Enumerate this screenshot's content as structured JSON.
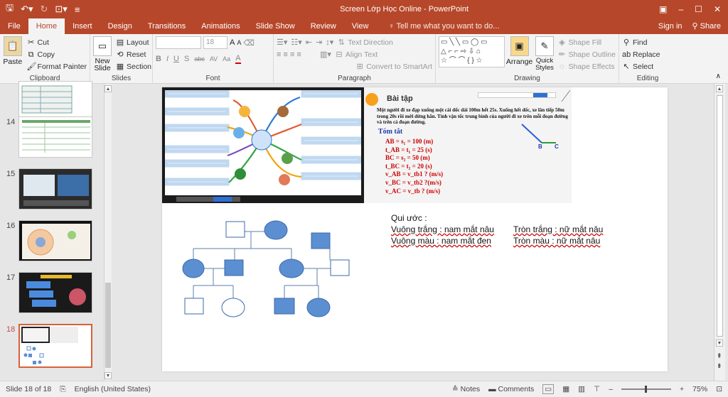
{
  "window": {
    "title": "Screen Lớp Học Online - PowerPoint",
    "controls": [
      "▣",
      "–",
      "☐",
      "✕"
    ]
  },
  "tabs": {
    "items": [
      "File",
      "Home",
      "Insert",
      "Design",
      "Transitions",
      "Animations",
      "Slide Show",
      "Review",
      "View"
    ],
    "active": "Home",
    "tellme": "Tell me what you want to do...",
    "signin": "Sign in",
    "share": "Share"
  },
  "ribbon": {
    "clipboard": {
      "paste": "Paste",
      "cut": "Cut",
      "copy": "Copy",
      "format_painter": "Format Painter",
      "label": "Clipboard"
    },
    "slides": {
      "new_slide": "New Slide",
      "layout": "Layout",
      "reset": "Reset",
      "section": "Section",
      "label": "Slides"
    },
    "font": {
      "size": "18",
      "label": "Font",
      "bold": "B",
      "italic": "I",
      "underline": "U",
      "strike": "S",
      "shadow": "abc",
      "spacing": "AV",
      "case": "Aa",
      "color": "A",
      "grow": "A",
      "shrink": "A"
    },
    "paragraph": {
      "text_direction": "Text Direction",
      "align_text": "Align Text",
      "smartart": "Convert to SmartArt",
      "label": "Paragraph"
    },
    "drawing": {
      "arrange": "Arrange",
      "quick_styles": "Quick Styles",
      "shape_fill": "Shape Fill",
      "shape_outline": "Shape Outline",
      "shape_effects": "Shape Effects",
      "label": "Drawing"
    },
    "editing": {
      "find": "Find",
      "replace": "Replace",
      "select": "Select",
      "label": "Editing"
    }
  },
  "thumbnails": [
    {
      "num": "",
      "kind": "table"
    },
    {
      "num": "14",
      "kind": "table"
    },
    {
      "num": "15",
      "kind": "screen"
    },
    {
      "num": "16",
      "kind": "cell"
    },
    {
      "num": "17",
      "kind": "content"
    },
    {
      "num": "18",
      "kind": "pedigree"
    }
  ],
  "slide": {
    "exercise": {
      "title": "Bài tập",
      "problem": "Một người đi xe đạp xuống một cái dốc dài 100m hết 25s. Xuống hết dốc, xe lăn tiếp 50m trong 20s rồi mới dừng hẳn. Tính vận tốc trung bình của người đi xe trên mỗi đoạn đường và trên cả đoạn đường.",
      "summary_title": "Tóm tắt",
      "lines": [
        "AB = s₁ = 100 (m)",
        "t_AB = t₁ = 25 (s)",
        "BC = s₂ = 50 (m)",
        "t_BC = t₂ = 20 (s)",
        "v_AB = v_tb1 ? (m/s)",
        "v_BC = v_tb2 ?(m/s)",
        "v_AC = v_tb ? (m/s)"
      ],
      "label_b": "B",
      "label_c": "C"
    },
    "legend": {
      "title": "Qui ước :",
      "items": [
        [
          "Vuông trắng : nam mắt nâu",
          "Tròn trắng : nữ mắt nâu"
        ],
        [
          "Vuông màu : nam mắt đen",
          "Tròn màu : nữ mắt nâu"
        ]
      ]
    },
    "pedigree_color": "#5b8fd2"
  },
  "status": {
    "slide_info": "Slide 18 of 18",
    "language": "English (United States)",
    "notes": "Notes",
    "comments": "Comments",
    "zoom": "75%"
  },
  "colors": {
    "accent": "#b7472a",
    "selection": "#d9603b"
  }
}
